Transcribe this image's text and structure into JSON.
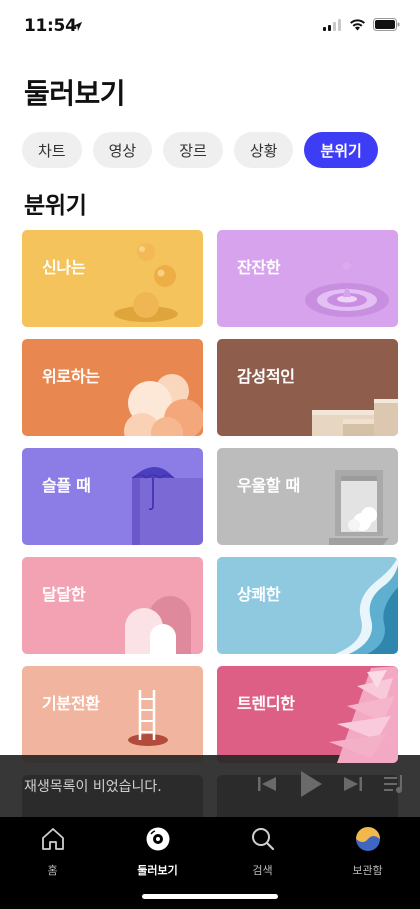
{
  "status": {
    "time": "11:54"
  },
  "title": "둘러보기",
  "chips": [
    {
      "label": "차트",
      "active": false
    },
    {
      "label": "영상",
      "active": false
    },
    {
      "label": "장르",
      "active": false
    },
    {
      "label": "상황",
      "active": false
    },
    {
      "label": "분위기",
      "active": true
    }
  ],
  "section_title": "분위기",
  "cards": [
    {
      "label": "신나는",
      "color": "#f5c35c",
      "art": "bubbles"
    },
    {
      "label": "잔잔한",
      "color": "#d6a3ec",
      "art": "ripple"
    },
    {
      "label": "위로하는",
      "color": "#e8874f",
      "art": "clouds"
    },
    {
      "label": "감성적인",
      "color": "#8e5d4c",
      "art": "steps"
    },
    {
      "label": "슬플 때",
      "color": "#8b7ce6",
      "art": "umbrella"
    },
    {
      "label": "우울할 때",
      "color": "#bcbcbc",
      "art": "doorway"
    },
    {
      "label": "달달한",
      "color": "#f2a2b3",
      "art": "arches"
    },
    {
      "label": "상쾌한",
      "color": "#8ec9df",
      "art": "waves"
    },
    {
      "label": "기분전환",
      "color": "#f1b59f",
      "art": "ladder"
    },
    {
      "label": "트렌디한",
      "color": "#dd5f86",
      "art": "tree"
    },
    {
      "label": "",
      "color": "#555555",
      "art": "none"
    },
    {
      "label": "",
      "color": "#555555",
      "art": "none"
    }
  ],
  "player": {
    "empty_text": "재생목록이 비었습니다."
  },
  "tabs": [
    {
      "label": "홈",
      "icon": "home-icon",
      "active": false
    },
    {
      "label": "둘러보기",
      "icon": "disc-icon",
      "active": true
    },
    {
      "label": "검색",
      "icon": "search-icon",
      "active": false
    },
    {
      "label": "보관함",
      "icon": "library-avatar-icon",
      "active": false
    }
  ],
  "colors": {
    "accent": "#3d3df5",
    "tabbar": "#000000",
    "player": "#282828"
  }
}
